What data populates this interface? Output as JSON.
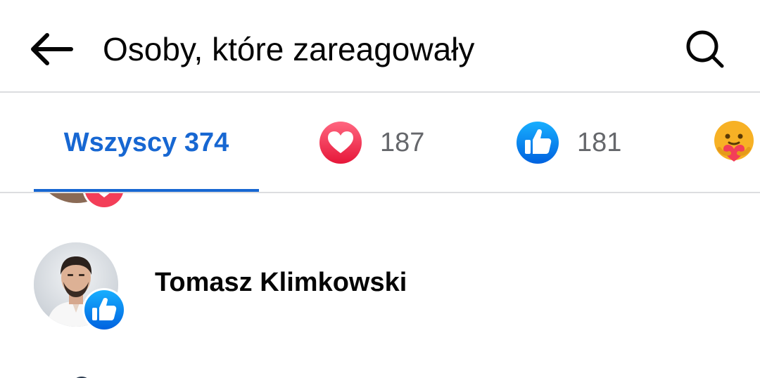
{
  "header": {
    "title": "Osoby, które zareagowały",
    "back_icon": "arrow-left-icon",
    "search_icon": "search-icon"
  },
  "tabs": [
    {
      "id": "all",
      "label": "Wszyscy 374",
      "selected": true
    },
    {
      "id": "love",
      "icon": "heart-reaction-icon",
      "count": "187"
    },
    {
      "id": "like",
      "icon": "like-reaction-icon",
      "count": "181"
    },
    {
      "id": "care",
      "icon": "care-reaction-icon"
    }
  ],
  "people": [
    {
      "name": "Tomasz Klimkowski",
      "reaction": "like-reaction-icon"
    }
  ],
  "colors": {
    "accent": "#1767d2",
    "like_blue": "#1877f2",
    "love_red": "#f33e58",
    "care_yellow": "#f7b125",
    "muted_text": "#65676b",
    "divider": "#dcdde0"
  }
}
